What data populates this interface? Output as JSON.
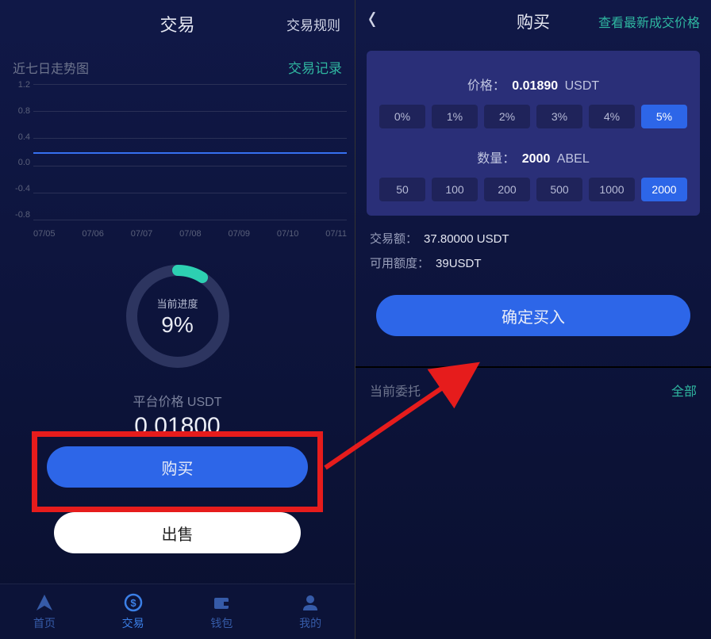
{
  "left": {
    "title": "交易",
    "rules": "交易规则",
    "trendLabel": "近七日走势图",
    "recordsLink": "交易记录",
    "gaugeLabel": "当前进度",
    "gaugeValue": "9%",
    "gaugePercent": 9,
    "priceLabel": "平台价格 USDT",
    "priceValue": "0.01800",
    "buyBtn": "购买",
    "sellBtn": "出售",
    "tabs": [
      "首页",
      "交易",
      "钱包",
      "我的"
    ]
  },
  "right": {
    "title": "购买",
    "link": "查看最新成交价格",
    "priceLabel": "价格：",
    "priceValue": "0.01890",
    "priceUnit": "USDT",
    "pctOptions": [
      "0%",
      "1%",
      "2%",
      "3%",
      "4%",
      "5%"
    ],
    "pctSelected": "5%",
    "qtyLabel": "数量：",
    "qtyValue": "2000",
    "qtyUnit": "ABEL",
    "qtyOptions": [
      "50",
      "100",
      "200",
      "500",
      "1000",
      "2000"
    ],
    "qtySelected": "2000",
    "amountLabel": "交易额：",
    "amountValue": "37.80000 USDT",
    "availLabel": "可用额度：",
    "availValue": "39USDT",
    "confirmBtn": "确定买入",
    "ordersTitle": "当前委托",
    "ordersAll": "全部"
  },
  "chart_data": {
    "type": "line",
    "x": [
      "07/05",
      "07/06",
      "07/07",
      "07/08",
      "07/09",
      "07/10",
      "07/11"
    ],
    "values": [
      0,
      0,
      0,
      0,
      0,
      0,
      0
    ],
    "yticks": [
      1.2,
      0.8,
      0.4,
      0.0,
      -0.4,
      -0.8
    ],
    "ylim": [
      -0.8,
      1.2
    ],
    "title": "近七日走势图",
    "xlabel": "",
    "ylabel": ""
  }
}
